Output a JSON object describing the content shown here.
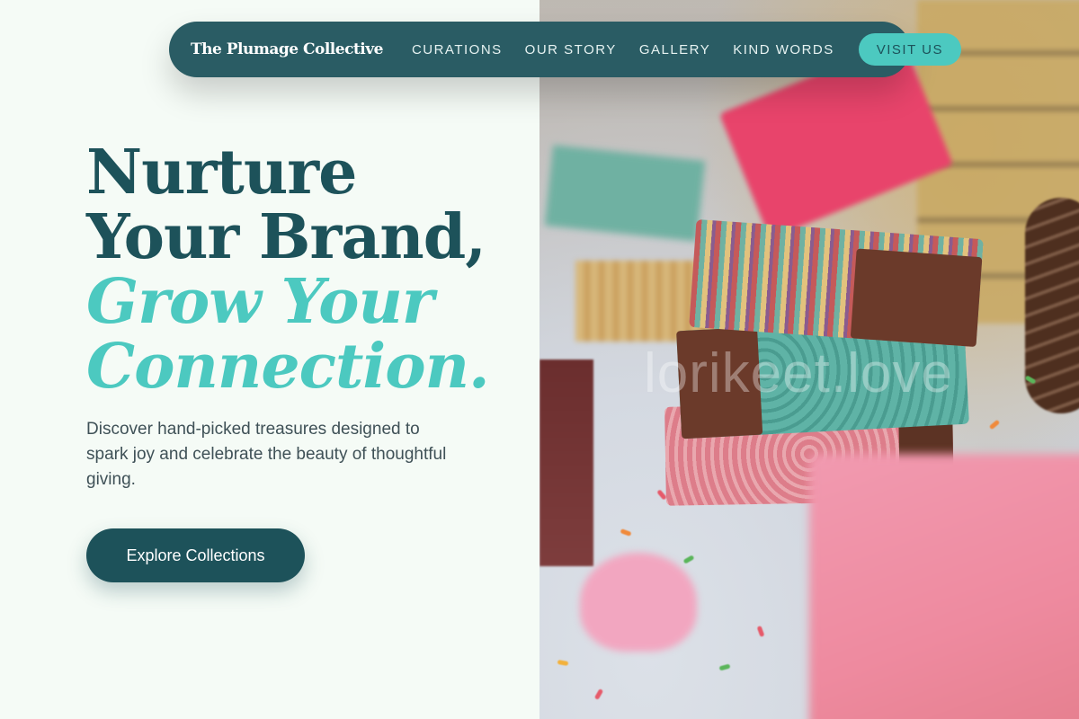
{
  "nav": {
    "brand": "The Plumage Collective",
    "links": [
      "CURATIONS",
      "OUR STORY",
      "GALLERY",
      "KIND WORDS"
    ],
    "cta_label": "VISIT US"
  },
  "hero": {
    "headline_line1": "Nurture",
    "headline_line2": "Your Brand,",
    "headline_line3": "Grow Your",
    "headline_line4": "Connection.",
    "subcopy": "Discover hand-picked treasures designed to spark joy and celebrate the beauty of thoughtful giving.",
    "cta_label": "Explore Collections"
  },
  "photo": {
    "watermark": "lorikeet.love"
  },
  "colors": {
    "primary_dark": "#1d525a",
    "accent_teal": "#4cc9c0",
    "background": "#f5fbf6",
    "nav_background": "#2a5c64"
  }
}
